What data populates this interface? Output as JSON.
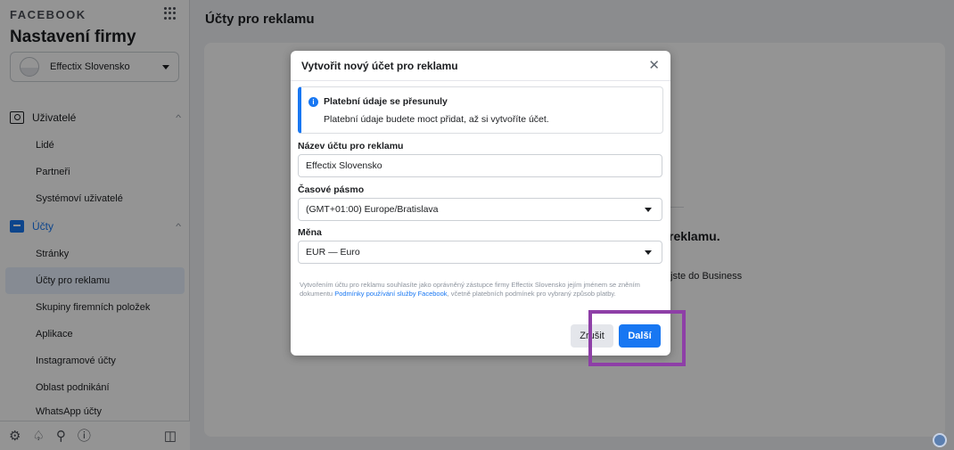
{
  "sidebar": {
    "brand": "FACEBOOK",
    "business_title": "Nastavení firmy",
    "business_selector": "Effectix Slovensko",
    "sections": [
      {
        "label": "Uživatelé",
        "items": [
          "Lidé",
          "Partneři",
          "Systémoví uživatelé"
        ]
      },
      {
        "label": "Účty",
        "items": [
          "Stránky",
          "Účty pro reklamu",
          "Skupiny firemních položek",
          "Aplikace",
          "Instagramové účty",
          "Oblast podnikání",
          "WhatsApp účty"
        ]
      }
    ],
    "selected_item": "Účty pro reklamu",
    "bottom_icons": [
      "settings-icon",
      "bell-icon",
      "search-icon",
      "help-icon",
      "dock-icon"
    ]
  },
  "main": {
    "title": "Účty pro reklamu",
    "bg_heading": "reklamu.",
    "bg_text": "jste do Business"
  },
  "modal": {
    "title": "Vytvořit nový účet pro reklamu",
    "notice": {
      "title": "Platební údaje se přesunuly",
      "text": "Platební údaje budete moct přidat, až si vytvoříte účet."
    },
    "fields": {
      "account_name_label": "Název účtu pro reklamu",
      "account_name_value": "Effectix Slovensko",
      "timezone_label": "Časové pásmo",
      "timezone_value": "(GMT+01:00) Europe/Bratislava",
      "currency_label": "Měna",
      "currency_value": "EUR — Euro"
    },
    "legal": {
      "before": "Vytvořením účtu pro reklamu souhlasíte jako oprávněný zástupce firmy Effectix Slovensko jejím jménem se zněním dokumentu ",
      "link": "Podmínky používání služby Facebook",
      "after": ", včetně platebních podmínek pro vybraný způsob platby."
    },
    "cancel_label": "Zrušit",
    "next_label": "Další"
  },
  "colors": {
    "accent": "#1877f2",
    "highlight": "#8e3fa7",
    "selected_bg": "#e7f0fd"
  }
}
